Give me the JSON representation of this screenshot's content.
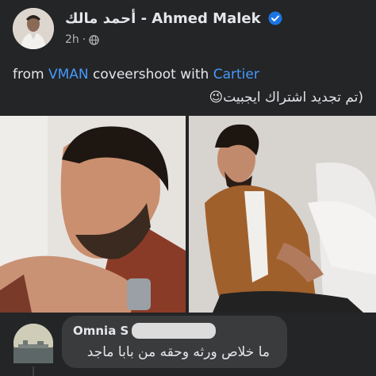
{
  "post": {
    "author_name": "أحمد مالك - Ahmed Malek",
    "timestamp": "2h",
    "privacy_icon": "globe-icon",
    "text": {
      "prefix": "from ",
      "tag1": "VMAN",
      "middle": " coveershoot with ",
      "tag2": "Cartier",
      "line2": "(تم تجديد اشتراك ايجبيت",
      "emoji": "😉"
    },
    "photos": [
      {
        "alt": "Close-up portrait, resting chin on hand"
      },
      {
        "alt": "Seated in brown suede jacket"
      }
    ]
  },
  "comment": {
    "author": "Omnia S",
    "text": "ما خلاص ورثه وحقه من بابا ماجد"
  },
  "colors": {
    "background": "#242526",
    "text": "#e4e6eb",
    "secondary": "#b0b3b8",
    "link": "#4599ff",
    "verified": "#1b74e4",
    "comment_bubble": "#3a3b3c"
  }
}
